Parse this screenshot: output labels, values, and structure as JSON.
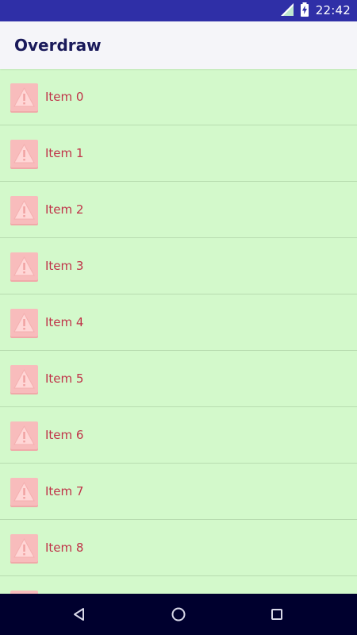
{
  "status_bar": {
    "time": "22:42",
    "icons": [
      "signal-icon",
      "battery-charging-icon"
    ]
  },
  "app_bar": {
    "title": "Overdraw"
  },
  "list": {
    "items": [
      {
        "label": "Item 0",
        "icon": "warning-icon"
      },
      {
        "label": "Item 1",
        "icon": "warning-icon"
      },
      {
        "label": "Item 2",
        "icon": "warning-icon"
      },
      {
        "label": "Item 3",
        "icon": "warning-icon"
      },
      {
        "label": "Item 4",
        "icon": "warning-icon"
      },
      {
        "label": "Item 5",
        "icon": "warning-icon"
      },
      {
        "label": "Item 6",
        "icon": "warning-icon"
      },
      {
        "label": "Item 7",
        "icon": "warning-icon"
      },
      {
        "label": "Item 8",
        "icon": "warning-icon"
      },
      {
        "label": "",
        "icon": "warning-icon"
      }
    ]
  },
  "nav_bar": {
    "buttons": [
      "back-icon",
      "home-icon",
      "recents-icon"
    ]
  },
  "colors": {
    "status_bar": "#2f2fa7",
    "app_bar": "#f5f5f9",
    "list_background": "#d3f9cb",
    "item_text": "#c0354a",
    "icon_fill": "#f8bcbc",
    "nav_bar": "#00002e"
  }
}
